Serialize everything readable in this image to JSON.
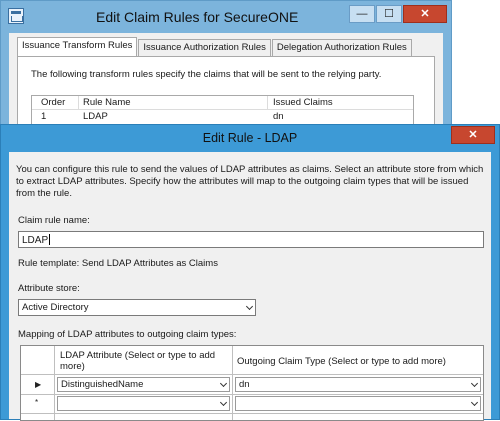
{
  "bg_window": {
    "title": "Edit Claim Rules for SecureONE",
    "tabs": [
      "Issuance Transform Rules",
      "Issuance Authorization Rules",
      "Delegation Authorization Rules"
    ],
    "description": "The following transform rules specify the claims that will be sent to the relying party.",
    "columns": [
      "Order",
      "Rule Name",
      "Issued Claims"
    ],
    "rows": [
      {
        "order": "1",
        "name": "LDAP",
        "claims": "dn"
      }
    ]
  },
  "dialog": {
    "title": "Edit Rule - LDAP",
    "intro": "You can configure this rule to send the values of LDAP attributes as claims. Select an attribute store from which to extract LDAP attributes. Specify how the attributes will map to the outgoing claim types that will be issued from the rule.",
    "claim_rule_name_label": "Claim rule name:",
    "claim_rule_name_value": "LDAP",
    "rule_template": "Rule template: Send LDAP Attributes as Claims",
    "attribute_store_label": "Attribute store:",
    "attribute_store_value": "Active Directory",
    "mapping_label": "Mapping of LDAP attributes to outgoing claim types:",
    "grid": {
      "col1": "LDAP Attribute (Select or type to add more)",
      "col2": "Outgoing Claim Type (Select or type to add more)",
      "rows": [
        {
          "marker": "▶",
          "ldap": "DistinguishedName",
          "claim": "dn"
        },
        {
          "marker": "*",
          "ldap": "",
          "claim": ""
        }
      ]
    }
  },
  "caption_buttons": {
    "minimize": "—",
    "maximize": "☐",
    "close": "✕"
  }
}
